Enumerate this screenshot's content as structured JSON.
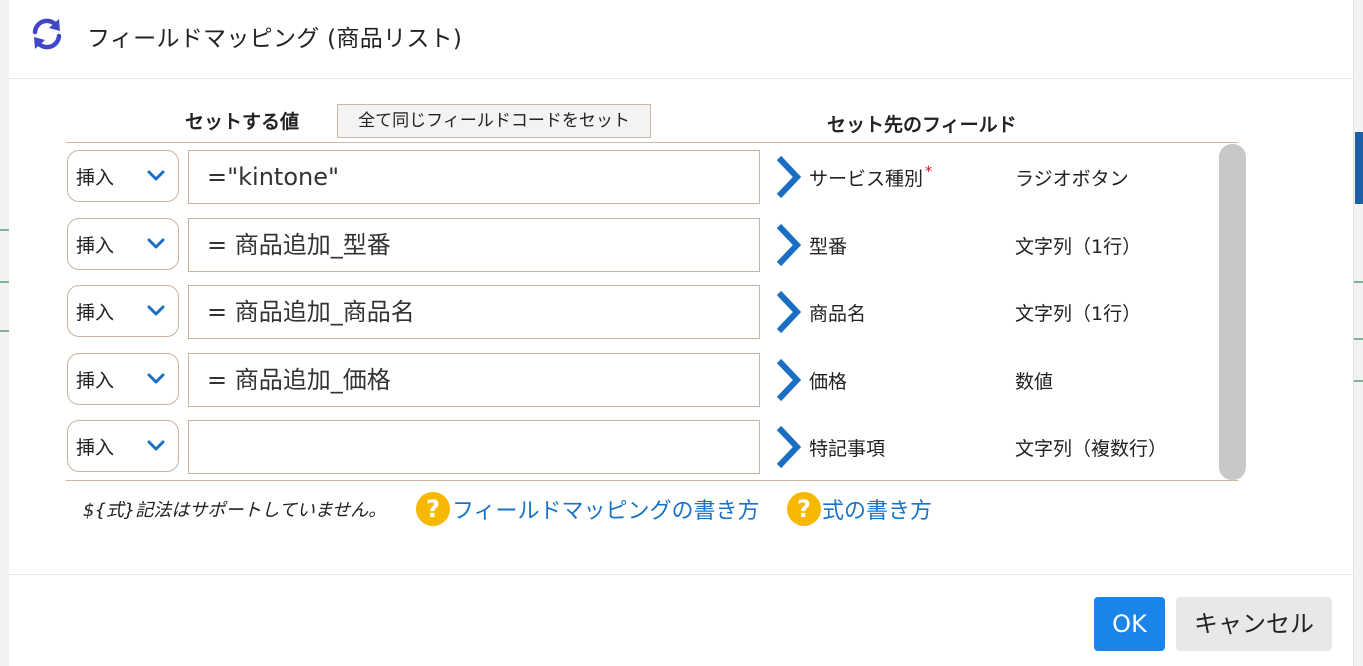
{
  "dialog": {
    "title": "フィールドマッピング (商品リスト)",
    "refresh_icon": "refresh-icon"
  },
  "columns": {
    "value_header": "セットする値",
    "set_all_button": "全て同じフィールドコードをセット",
    "field_header": "セット先のフィールド"
  },
  "rows": [
    {
      "operation": "挿入",
      "value": "=\"kintone\"",
      "field": "サービス種別",
      "required": "*",
      "type": "ラジオボタン"
    },
    {
      "operation": "挿入",
      "value": "= 商品追加_型番",
      "field": "型番",
      "type": "文字列（1行）"
    },
    {
      "operation": "挿入",
      "value": "= 商品追加_商品名",
      "field": "商品名",
      "type": "文字列（1行）"
    },
    {
      "operation": "挿入",
      "value": "= 商品追加_価格",
      "field": "価格",
      "type": "数値"
    },
    {
      "operation": "挿入",
      "value": "",
      "field": "特記事項",
      "type": "文字列（複数行）"
    }
  ],
  "footer_note": {
    "text": "${式}記法はサポートしていません。",
    "help_mapping": "フィールドマッピングの書き方",
    "help_formula": "式の書き方",
    "help_icon_glyph": "?"
  },
  "buttons": {
    "ok": "OK",
    "cancel": "キャンセル"
  },
  "colors": {
    "accent": "#1a84e8",
    "link": "#1a73c9",
    "help_icon": "#f6b800",
    "arrow": "#1a6fc2",
    "required": "#d0021b"
  }
}
